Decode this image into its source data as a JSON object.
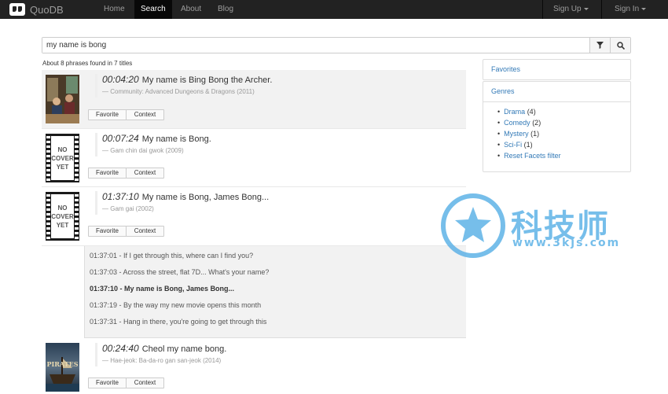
{
  "brand": "QuoDB",
  "nav": {
    "items": [
      "Home",
      "Search",
      "About",
      "Blog"
    ],
    "signup": "Sign Up",
    "signin": "Sign In"
  },
  "search": {
    "value": "my name is bong"
  },
  "found_text": "About 8 phrases found in 7 titles",
  "buttons": {
    "favorite": "Favorite",
    "context": "Context"
  },
  "results": [
    {
      "time": "00:04:20",
      "quote": "My name is Bing Bong the Archer.",
      "source": "— Community: Advanced Dungeons & Dragons (2011)"
    },
    {
      "time": "00:07:24",
      "quote": "My name is Bong.",
      "source": "— Gam chin dai gwok (2009)"
    },
    {
      "time": "01:37:10",
      "quote": "My name is Bong, James Bong...",
      "source": "— Gam gai (2002)"
    },
    {
      "time": "00:24:40",
      "quote": "Cheol my name bong.",
      "source": "— Hae-jeok: Ba-da-ro gan san-jeok (2014)"
    }
  ],
  "no_cover": [
    "NO",
    "COVER",
    "YET"
  ],
  "pirates_poster_text": "PIRATES",
  "context_lines": [
    "01:37:01 - If I get through this, where can I find you?",
    "01:37:03 - Across the street, flat 7D... What's your name?",
    "01:37:10 - My name is Bong, James Bong...",
    "01:37:19 - By the way my new movie opens this month",
    "01:37:31 - Hang in there, you're going to get through this"
  ],
  "sidebar": {
    "favorites": "Favorites",
    "genres_title": "Genres",
    "genres": [
      {
        "name": "Drama",
        "count": "(4)"
      },
      {
        "name": "Comedy",
        "count": "(2)"
      },
      {
        "name": "Mystery",
        "count": "(1)"
      },
      {
        "name": "Sci-Fi",
        "count": "(1)"
      }
    ],
    "reset": "Reset Facets filter"
  },
  "watermark": {
    "title": "科技师",
    "url": "www.3kjs.com"
  },
  "colors": {
    "navbar": "#222222",
    "link": "#337ab7",
    "highlight": "#f2f2f2",
    "watermark": "#55aee6"
  }
}
